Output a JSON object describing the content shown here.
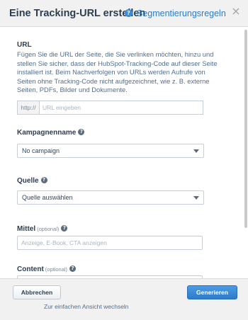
{
  "header": {
    "title": "Eine Tracking-URL erstellen",
    "help_link": "Segmentierungsregeln",
    "help_icon": "question-circle-icon",
    "close_icon": "close-icon",
    "close_glyph": "×"
  },
  "url_section": {
    "label": "URL",
    "description": "Fügen Sie die URL der Seite, die Sie verlinken möchten, hinzu und stellen Sie sicher, dass der HubSpot-Tracking-Code auf dieser Seite installiert ist. Beim Nachverfolgen von URLs werden Aufrufe von Seiten ohne Tracking-Code nicht aufgezeichnet, wie z. B. externe Seiten, PDFs, Bilder und Dokumente.",
    "prefix": "http://",
    "placeholder": "URL eingeben",
    "value": ""
  },
  "campaign": {
    "label": "Kampagnenname",
    "selected": "No campaign"
  },
  "source": {
    "label": "Quelle",
    "selected": "Quelle auswählen"
  },
  "medium": {
    "label": "Mittel",
    "optional": "(optional)",
    "placeholder": "Anzeige, E-Book, CTA anzeigen"
  },
  "content": {
    "label": "Content",
    "optional": "(optional)"
  },
  "footer": {
    "cancel_label": "Abbrechen",
    "generate_label": "Generieren",
    "simple_view_link": "Zur einfachen Ansicht wechseln"
  },
  "colors": {
    "primary_button": "#2d7bc9",
    "link": "#2f7bc3",
    "header_bg": "#f1f1f1"
  }
}
